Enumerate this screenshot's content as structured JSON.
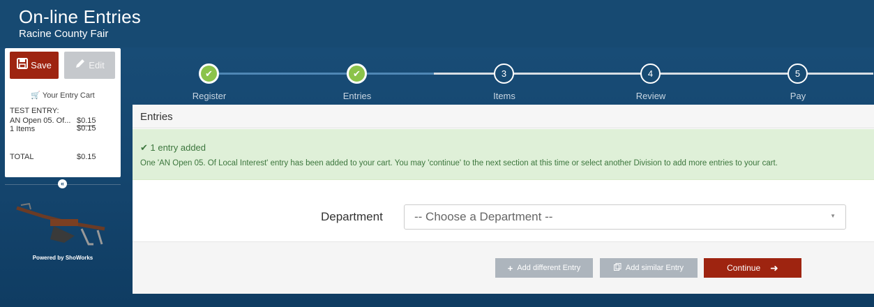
{
  "header": {
    "title": "On-line Entries",
    "subtitle": "Racine County Fair"
  },
  "cart": {
    "save_label": "Save",
    "edit_label": "Edit",
    "title": "Your Entry Cart",
    "entry_type": "TEST ENTRY:",
    "item_name": "AN Open 05. Of...",
    "item_price": "$0.15",
    "items_label": "1 Items",
    "items_price": "$0.15",
    "total_label": "TOTAL",
    "total_price": "$0.15",
    "collapse_icon": "«"
  },
  "branding": {
    "powered_by": "Powered by ShoWorks"
  },
  "steps": [
    {
      "label": "Register",
      "marker": "✔",
      "state": "done"
    },
    {
      "label": "Entries",
      "marker": "✔",
      "state": "done"
    },
    {
      "label": "Items",
      "marker": "3",
      "state": "todo"
    },
    {
      "label": "Review",
      "marker": "4",
      "state": "todo"
    },
    {
      "label": "Pay",
      "marker": "5",
      "state": "todo"
    }
  ],
  "panel": {
    "heading": "Entries",
    "alert_title": "✔ 1 entry added",
    "alert_message": "One 'AN Open 05. Of Local Interest' entry has been added to your cart. You may 'continue' to the next section at this time or select another Division to add more entries to your cart.",
    "department_label": "Department",
    "department_placeholder": "-- Choose a Department --",
    "add_different_label": "Add different Entry",
    "add_similar_label": "Add similar Entry",
    "continue_label": "Continue"
  },
  "colors": {
    "header_bg": "#174a72",
    "accent_red": "#9e2410",
    "step_done": "#8bc34a",
    "alert_bg": "#dff0d8",
    "alert_text": "#3c763d"
  }
}
